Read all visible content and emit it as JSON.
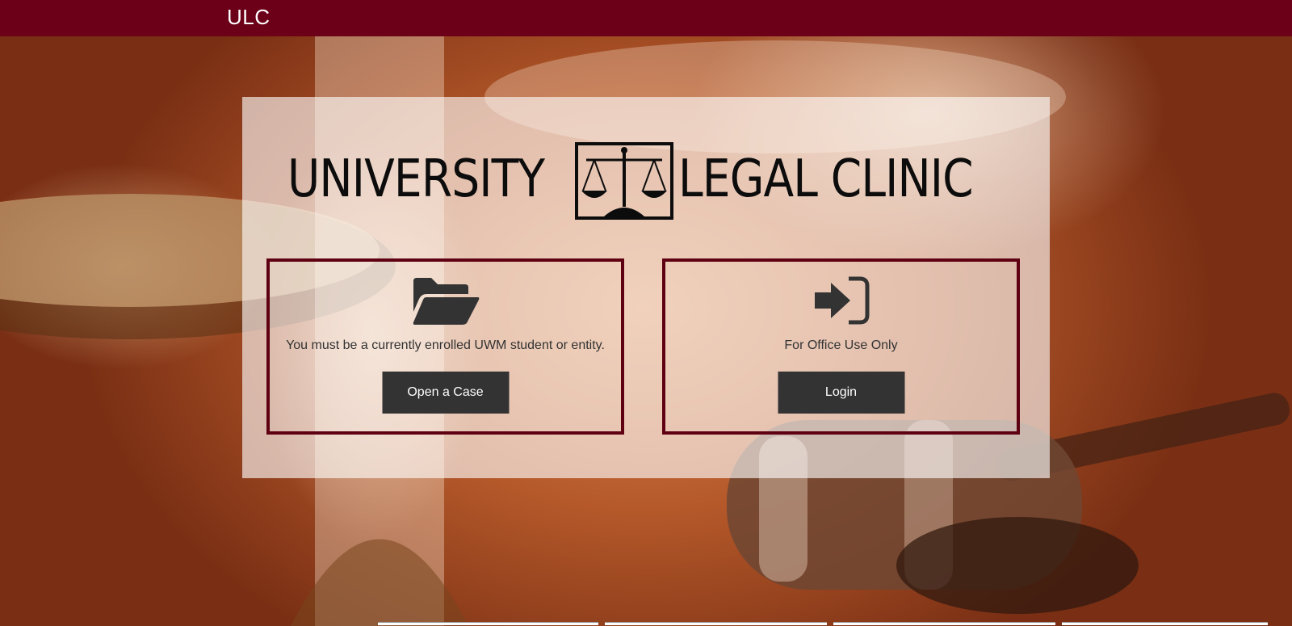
{
  "navbar": {
    "brand": "ULC",
    "color": "#6b0018"
  },
  "logo": {
    "left_word": "UNIVERSITY",
    "right_word": "LEGAL CLINIC",
    "emblem_icon": "scales-of-justice-icon"
  },
  "cards": [
    {
      "icon": "folder-open-icon",
      "text": "You must be a currently enrolled UWM student or entity.",
      "button_label": "Open a Case"
    },
    {
      "icon": "sign-in-icon",
      "text": "For Office Use Only",
      "button_label": "Login"
    }
  ],
  "colors": {
    "accent": "#6b0018",
    "card_border": "#5e0012",
    "button": "#333333"
  }
}
